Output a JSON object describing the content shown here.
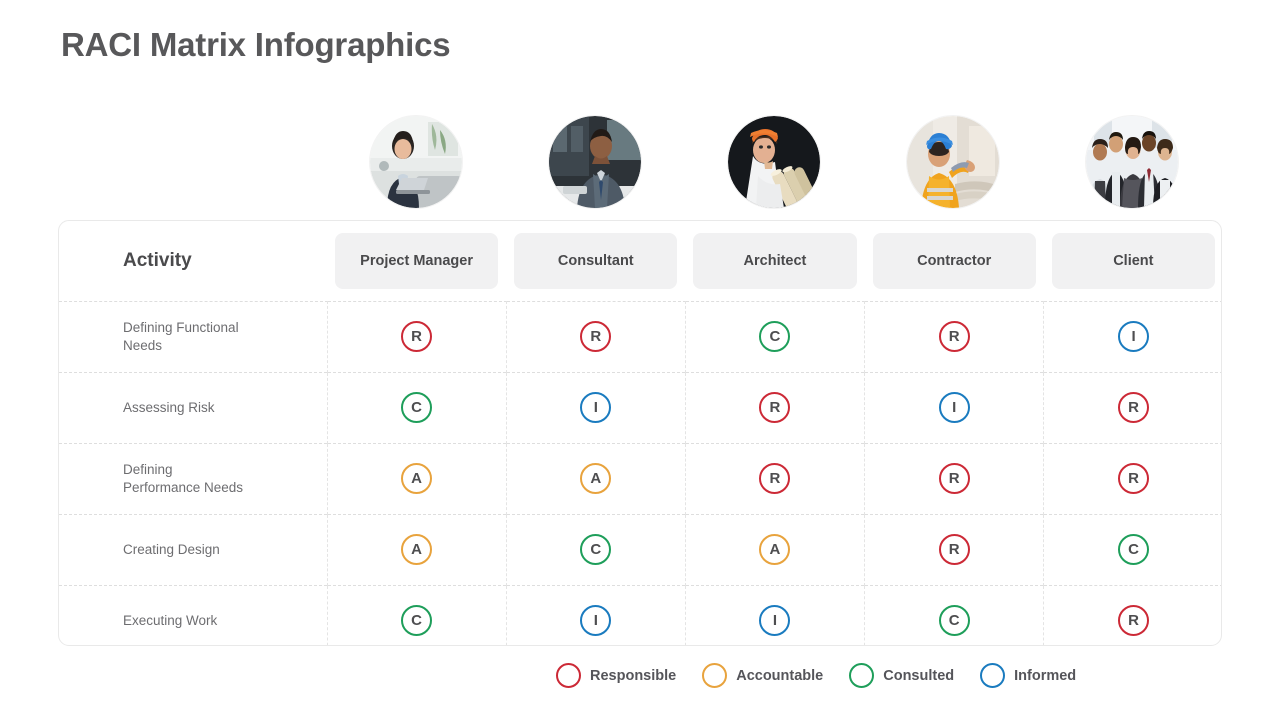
{
  "title": "RACI Matrix Infographics",
  "activity_header": "Activity",
  "avatars": [
    {
      "name": "avatar-project-manager",
      "alt": "businesswoman with laptop in office"
    },
    {
      "name": "avatar-consultant",
      "alt": "businessman at desk"
    },
    {
      "name": "avatar-architect",
      "alt": "woman in hard hat holding blueprints"
    },
    {
      "name": "avatar-contractor",
      "alt": "construction worker in safety vest"
    },
    {
      "name": "avatar-client",
      "alt": "group of business people"
    }
  ],
  "roles": [
    "Project Manager",
    "Consultant",
    "Architect",
    "Contractor",
    "Client"
  ],
  "rows": [
    {
      "activity": "Defining Functional\nNeeds",
      "values": [
        "R",
        "R",
        "C",
        "R",
        "I"
      ]
    },
    {
      "activity": "Assessing Risk",
      "values": [
        "C",
        "I",
        "R",
        "I",
        "R"
      ]
    },
    {
      "activity": "Defining\nPerformance Needs",
      "values": [
        "A",
        "A",
        "R",
        "R",
        "R"
      ]
    },
    {
      "activity": "Creating Design",
      "values": [
        "A",
        "C",
        "A",
        "R",
        "C"
      ]
    },
    {
      "activity": "Executing Work",
      "values": [
        "C",
        "I",
        "I",
        "C",
        "R"
      ]
    }
  ],
  "legend": [
    {
      "key": "R",
      "label": "Responsible",
      "color": "#cc2936"
    },
    {
      "key": "A",
      "label": "Accountable",
      "color": "#e8a33d"
    },
    {
      "key": "C",
      "label": "Consulted",
      "color": "#1e9e5a"
    },
    {
      "key": "I",
      "label": "Informed",
      "color": "#1a7bbf"
    }
  ],
  "colors": {
    "responsible": "#cc2936",
    "accountable": "#e8a33d",
    "consulted": "#1e9e5a",
    "informed": "#1a7bbf",
    "title_text": "#58585a",
    "chip_bg": "#f1f1f2",
    "card_border": "#e9e9e9"
  }
}
